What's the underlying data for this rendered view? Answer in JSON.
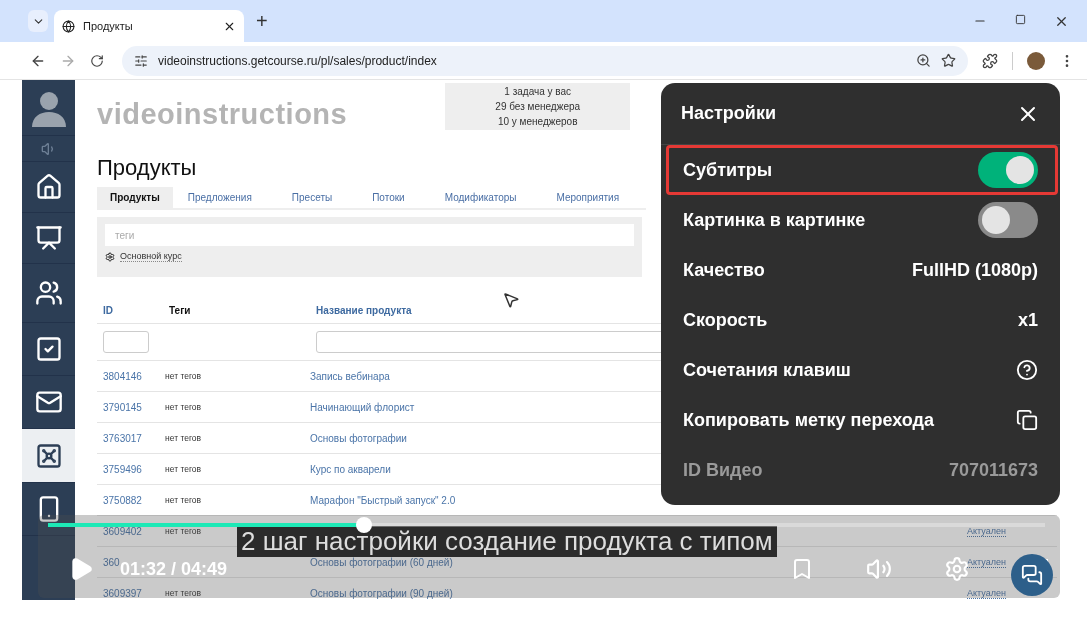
{
  "browser": {
    "tabs": [
      {
        "title": "Продукты",
        "selected": true
      }
    ],
    "new_tab": "+",
    "url": "videoinstructions.getcourse.ru/pl/sales/product/index",
    "forward_disabled": true
  },
  "app": {
    "sidebar": [
      {
        "selected": false
      },
      {
        "selected": false
      },
      {
        "selected": false
      },
      {
        "selected": false
      },
      {
        "selected": false
      },
      {
        "selected": false
      },
      {
        "selected": false
      },
      {
        "selected": true
      },
      {
        "selected": false
      }
    ],
    "logo": "videoinstructions",
    "tasks": [
      "1 задача у вас",
      "29 без менеджера",
      "10 у менеджеров"
    ],
    "title": "Продукты",
    "tabs": [
      {
        "label": "Продукты",
        "selected": true
      },
      {
        "label": "Предложения",
        "selected": false
      },
      {
        "label": "Пресеты",
        "selected": false
      },
      {
        "label": "Потоки",
        "selected": false
      },
      {
        "label": "Модификаторы",
        "selected": false
      },
      {
        "label": "Мероприятия",
        "selected": false
      }
    ],
    "filter": {
      "placeholder": "теги",
      "preset": "Основной курс"
    },
    "columns": [
      {
        "label": "ID",
        "sortable": true
      },
      {
        "label": "Теги",
        "sortable": false
      },
      {
        "label": "Название продукта",
        "sortable": true
      }
    ],
    "rows": [
      {
        "id": "3804146",
        "tags": "нет тегов",
        "name": "Запись вебинара"
      },
      {
        "id": "3790145",
        "tags": "нет тегов",
        "name": "Начинающий флорист"
      },
      {
        "id": "3763017",
        "tags": "нет тегов",
        "name": "Основы фотографии"
      },
      {
        "id": "3759496",
        "tags": "нет тегов",
        "name": "Курс по акварели"
      },
      {
        "id": "3750882",
        "tags": "нет тегов",
        "name": "Марафон \"Быстрый запуск\" 2.0"
      },
      {
        "id": "3609402",
        "tags": "нет тегов",
        "status": "Актуален"
      },
      {
        "id": "360",
        "name": "Основы фотографии (60 дней)",
        "status": "Актуален"
      },
      {
        "id": "3609397",
        "tags": "нет тегов",
        "name": "Основы фотографии (90 дней)",
        "status": "Актуален"
      }
    ]
  },
  "player": {
    "settings": {
      "title": "Настройки",
      "items": [
        {
          "kind": "toggle",
          "label": "Субтитры",
          "on": true,
          "highlighted": true
        },
        {
          "kind": "toggle",
          "label": "Картинка в картинке",
          "on": false,
          "highlighted": false
        },
        {
          "kind": "value",
          "label": "Качество",
          "value": "FullHD (1080p)"
        },
        {
          "kind": "value",
          "label": "Скорость",
          "value": "x1"
        },
        {
          "kind": "help",
          "label": "Сочетания клавиш"
        },
        {
          "kind": "copy",
          "label": "Копировать метку перехода"
        },
        {
          "kind": "info",
          "label": "ID Видео",
          "value": "707011673"
        }
      ]
    },
    "progress": {
      "level": 0.317
    },
    "subtitle": "2 шаг настройки создание продукта с типом",
    "time": "01:32 / 04:49",
    "playing": false
  }
}
